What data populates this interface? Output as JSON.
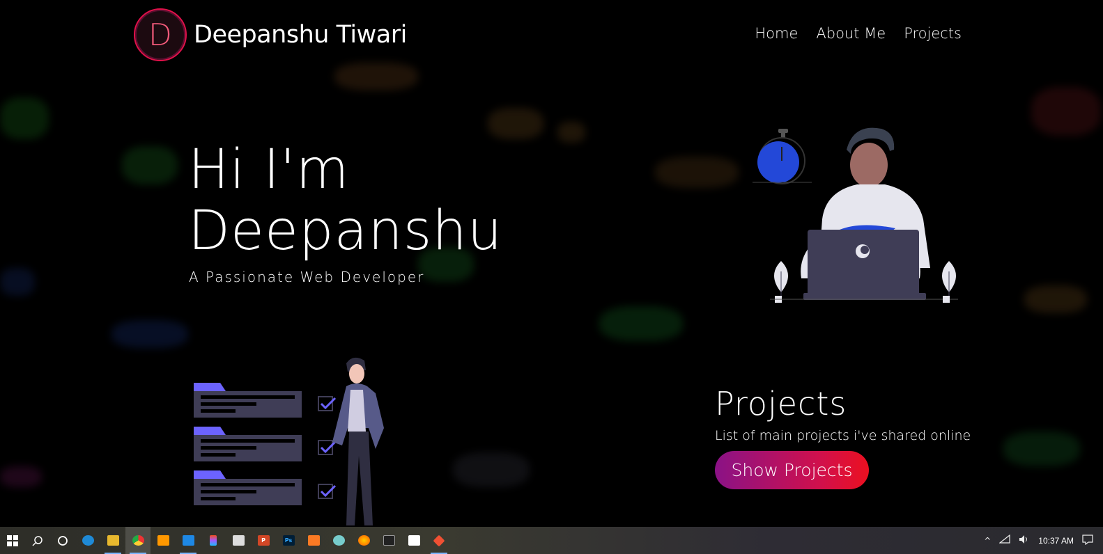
{
  "header": {
    "logo_letter": "D",
    "brand_name": "Deepanshu Tiwari",
    "nav": [
      "Home",
      "About Me",
      "Projects"
    ]
  },
  "hero": {
    "line1": "Hi I'm",
    "line2": "Deepanshu",
    "subtitle": "A Passionate Web Developer"
  },
  "projects": {
    "title": "Projects",
    "description": "List of main projects i've shared online",
    "button_label": "Show Projects"
  },
  "taskbar": {
    "apps": [
      "windows-start",
      "search",
      "cortana",
      "edge",
      "file-explorer",
      "chrome",
      "sublime-text",
      "vscode",
      "figma",
      "camera",
      "powerpoint",
      "photoshop",
      "xampp",
      "paint",
      "firefox",
      "terminal",
      "store",
      "git"
    ],
    "clock": "10:37 AM"
  },
  "colors": {
    "background": "#000000",
    "accent_start": "#8a1286",
    "accent_end": "#ec1020",
    "logo_ring": "#e0114a"
  }
}
